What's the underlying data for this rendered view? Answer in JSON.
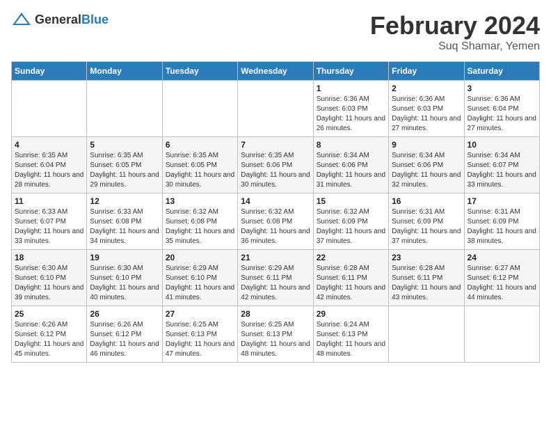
{
  "logo": {
    "text_general": "General",
    "text_blue": "Blue"
  },
  "title": {
    "month_year": "February 2024",
    "location": "Suq Shamar, Yemen"
  },
  "weekdays": [
    "Sunday",
    "Monday",
    "Tuesday",
    "Wednesday",
    "Thursday",
    "Friday",
    "Saturday"
  ],
  "weeks": [
    [
      {
        "day": "",
        "sunrise": "",
        "sunset": "",
        "daylight": ""
      },
      {
        "day": "",
        "sunrise": "",
        "sunset": "",
        "daylight": ""
      },
      {
        "day": "",
        "sunrise": "",
        "sunset": "",
        "daylight": ""
      },
      {
        "day": "",
        "sunrise": "",
        "sunset": "",
        "daylight": ""
      },
      {
        "day": "1",
        "sunrise": "Sunrise: 6:36 AM",
        "sunset": "Sunset: 6:03 PM",
        "daylight": "Daylight: 11 hours and 26 minutes."
      },
      {
        "day": "2",
        "sunrise": "Sunrise: 6:36 AM",
        "sunset": "Sunset: 6:03 PM",
        "daylight": "Daylight: 11 hours and 27 minutes."
      },
      {
        "day": "3",
        "sunrise": "Sunrise: 6:36 AM",
        "sunset": "Sunset: 6:04 PM",
        "daylight": "Daylight: 11 hours and 27 minutes."
      }
    ],
    [
      {
        "day": "4",
        "sunrise": "Sunrise: 6:35 AM",
        "sunset": "Sunset: 6:04 PM",
        "daylight": "Daylight: 11 hours and 28 minutes."
      },
      {
        "day": "5",
        "sunrise": "Sunrise: 6:35 AM",
        "sunset": "Sunset: 6:05 PM",
        "daylight": "Daylight: 11 hours and 29 minutes."
      },
      {
        "day": "6",
        "sunrise": "Sunrise: 6:35 AM",
        "sunset": "Sunset: 6:05 PM",
        "daylight": "Daylight: 11 hours and 30 minutes."
      },
      {
        "day": "7",
        "sunrise": "Sunrise: 6:35 AM",
        "sunset": "Sunset: 6:06 PM",
        "daylight": "Daylight: 11 hours and 30 minutes."
      },
      {
        "day": "8",
        "sunrise": "Sunrise: 6:34 AM",
        "sunset": "Sunset: 6:06 PM",
        "daylight": "Daylight: 11 hours and 31 minutes."
      },
      {
        "day": "9",
        "sunrise": "Sunrise: 6:34 AM",
        "sunset": "Sunset: 6:06 PM",
        "daylight": "Daylight: 11 hours and 32 minutes."
      },
      {
        "day": "10",
        "sunrise": "Sunrise: 6:34 AM",
        "sunset": "Sunset: 6:07 PM",
        "daylight": "Daylight: 11 hours and 33 minutes."
      }
    ],
    [
      {
        "day": "11",
        "sunrise": "Sunrise: 6:33 AM",
        "sunset": "Sunset: 6:07 PM",
        "daylight": "Daylight: 11 hours and 33 minutes."
      },
      {
        "day": "12",
        "sunrise": "Sunrise: 6:33 AM",
        "sunset": "Sunset: 6:08 PM",
        "daylight": "Daylight: 11 hours and 34 minutes."
      },
      {
        "day": "13",
        "sunrise": "Sunrise: 6:32 AM",
        "sunset": "Sunset: 6:08 PM",
        "daylight": "Daylight: 11 hours and 35 minutes."
      },
      {
        "day": "14",
        "sunrise": "Sunrise: 6:32 AM",
        "sunset": "Sunset: 6:08 PM",
        "daylight": "Daylight: 11 hours and 36 minutes."
      },
      {
        "day": "15",
        "sunrise": "Sunrise: 6:32 AM",
        "sunset": "Sunset: 6:09 PM",
        "daylight": "Daylight: 11 hours and 37 minutes."
      },
      {
        "day": "16",
        "sunrise": "Sunrise: 6:31 AM",
        "sunset": "Sunset: 6:09 PM",
        "daylight": "Daylight: 11 hours and 37 minutes."
      },
      {
        "day": "17",
        "sunrise": "Sunrise: 6:31 AM",
        "sunset": "Sunset: 6:09 PM",
        "daylight": "Daylight: 11 hours and 38 minutes."
      }
    ],
    [
      {
        "day": "18",
        "sunrise": "Sunrise: 6:30 AM",
        "sunset": "Sunset: 6:10 PM",
        "daylight": "Daylight: 11 hours and 39 minutes."
      },
      {
        "day": "19",
        "sunrise": "Sunrise: 6:30 AM",
        "sunset": "Sunset: 6:10 PM",
        "daylight": "Daylight: 11 hours and 40 minutes."
      },
      {
        "day": "20",
        "sunrise": "Sunrise: 6:29 AM",
        "sunset": "Sunset: 6:10 PM",
        "daylight": "Daylight: 11 hours and 41 minutes."
      },
      {
        "day": "21",
        "sunrise": "Sunrise: 6:29 AM",
        "sunset": "Sunset: 6:11 PM",
        "daylight": "Daylight: 11 hours and 42 minutes."
      },
      {
        "day": "22",
        "sunrise": "Sunrise: 6:28 AM",
        "sunset": "Sunset: 6:11 PM",
        "daylight": "Daylight: 11 hours and 42 minutes."
      },
      {
        "day": "23",
        "sunrise": "Sunrise: 6:28 AM",
        "sunset": "Sunset: 6:11 PM",
        "daylight": "Daylight: 11 hours and 43 minutes."
      },
      {
        "day": "24",
        "sunrise": "Sunrise: 6:27 AM",
        "sunset": "Sunset: 6:12 PM",
        "daylight": "Daylight: 11 hours and 44 minutes."
      }
    ],
    [
      {
        "day": "25",
        "sunrise": "Sunrise: 6:26 AM",
        "sunset": "Sunset: 6:12 PM",
        "daylight": "Daylight: 11 hours and 45 minutes."
      },
      {
        "day": "26",
        "sunrise": "Sunrise: 6:26 AM",
        "sunset": "Sunset: 6:12 PM",
        "daylight": "Daylight: 11 hours and 46 minutes."
      },
      {
        "day": "27",
        "sunrise": "Sunrise: 6:25 AM",
        "sunset": "Sunset: 6:13 PM",
        "daylight": "Daylight: 11 hours and 47 minutes."
      },
      {
        "day": "28",
        "sunrise": "Sunrise: 6:25 AM",
        "sunset": "Sunset: 6:13 PM",
        "daylight": "Daylight: 11 hours and 48 minutes."
      },
      {
        "day": "29",
        "sunrise": "Sunrise: 6:24 AM",
        "sunset": "Sunset: 6:13 PM",
        "daylight": "Daylight: 11 hours and 48 minutes."
      },
      {
        "day": "",
        "sunrise": "",
        "sunset": "",
        "daylight": ""
      },
      {
        "day": "",
        "sunrise": "",
        "sunset": "",
        "daylight": ""
      }
    ]
  ]
}
